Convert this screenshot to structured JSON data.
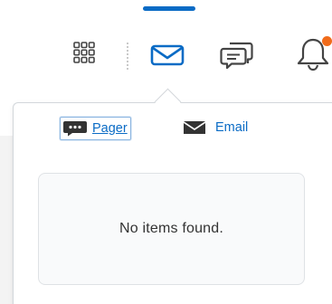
{
  "navbar": {
    "icons": [
      {
        "name": "apps-waffle-icon"
      },
      {
        "name": "mail-icon",
        "active": true
      },
      {
        "name": "chat-icon"
      },
      {
        "name": "bell-icon",
        "has_notification": true
      }
    ],
    "accent_color": "#0a6bc5",
    "notification_color": "#f06b1a"
  },
  "dropdown": {
    "tabs": [
      {
        "label": "Pager",
        "icon": "chat-bubble-icon",
        "selected": true
      },
      {
        "label": "Email",
        "icon": "envelope-icon",
        "selected": false
      }
    ],
    "empty_message": "No items found."
  }
}
